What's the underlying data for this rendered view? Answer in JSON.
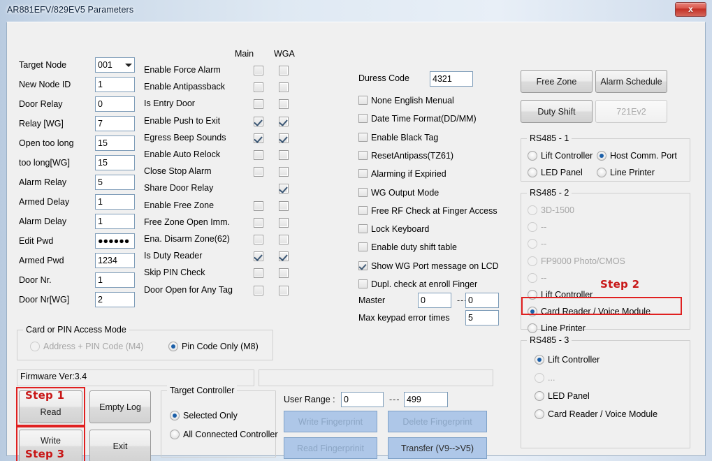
{
  "window": {
    "title": "AR881EFV/829EV5 Parameters",
    "close_label": "x",
    "close_icon": "close-icon"
  },
  "left_fields": [
    {
      "label": "Target Node",
      "value": "001",
      "type": "combo"
    },
    {
      "label": "New Node ID",
      "value": "1",
      "type": "text"
    },
    {
      "label": "Door Relay",
      "value": "0",
      "type": "text"
    },
    {
      "label": "Relay [WG]",
      "value": "7",
      "type": "text"
    },
    {
      "label": "Open too long",
      "value": "15",
      "type": "text"
    },
    {
      "label": "too long[WG]",
      "value": "15",
      "type": "text"
    },
    {
      "label": "Alarm Relay",
      "value": "5",
      "type": "text"
    },
    {
      "label": "Armed Delay",
      "value": "1",
      "type": "text"
    },
    {
      "label": "Alarm Delay",
      "value": "1",
      "type": "text"
    },
    {
      "label": "Edit Pwd",
      "value": "●●●●●●",
      "type": "text"
    },
    {
      "label": "Armed Pwd",
      "value": "1234",
      "type": "text"
    },
    {
      "label": "Door Nr.",
      "value": "1",
      "type": "text"
    },
    {
      "label": "Door Nr[WG]",
      "value": "2",
      "type": "text"
    }
  ],
  "checkbox_columns": {
    "main": "Main",
    "wga": "WGA"
  },
  "option_rows": [
    {
      "label": "Enable Force Alarm",
      "main": false,
      "wga": false,
      "main_present": true,
      "wga_present": true
    },
    {
      "label": "Enable Antipassback",
      "main": false,
      "wga": false,
      "main_present": true,
      "wga_present": true
    },
    {
      "label": "Is Entry Door",
      "main": false,
      "wga": false,
      "main_present": true,
      "wga_present": true
    },
    {
      "label": "Enable Push to Exit",
      "main": true,
      "wga": true,
      "main_present": true,
      "wga_present": true
    },
    {
      "label": "Egress Beep Sounds",
      "main": true,
      "wga": true,
      "main_present": true,
      "wga_present": true
    },
    {
      "label": "Enable Auto Relock",
      "main": false,
      "wga": false,
      "main_present": true,
      "wga_present": true
    },
    {
      "label": "Close Stop Alarm",
      "main": false,
      "wga": false,
      "main_present": true,
      "wga_present": true
    },
    {
      "label": "Share Door Relay",
      "main": false,
      "wga": true,
      "main_present": false,
      "wga_present": true
    },
    {
      "label": "Enable Free Zone",
      "main": false,
      "wga": false,
      "main_present": true,
      "wga_present": true
    },
    {
      "label": "Free Zone Open Imm.",
      "main": false,
      "wga": false,
      "main_present": true,
      "wga_present": true
    },
    {
      "label": "Ena. Disarm Zone(62)",
      "main": false,
      "wga": false,
      "main_present": true,
      "wga_present": true
    },
    {
      "label": "Is Duty Reader",
      "main": true,
      "wga": true,
      "main_present": true,
      "wga_present": true
    },
    {
      "label": "Skip PIN Check",
      "main": false,
      "wga": false,
      "main_present": true,
      "wga_present": true
    },
    {
      "label": "Door Open for Any Tag",
      "main": false,
      "wga": false,
      "main_present": true,
      "wga_present": true
    }
  ],
  "middle": {
    "duress_label": "Duress Code",
    "duress_value": "4321",
    "checks": [
      {
        "label": "None English Menual",
        "checked": false
      },
      {
        "label": "Date Time Format(DD/MM)",
        "checked": false
      },
      {
        "label": "Enable Black Tag",
        "checked": false
      },
      {
        "label": "ResetAntipass(TZ61)",
        "checked": false
      },
      {
        "label": "Alarming if Expiried",
        "checked": false
      },
      {
        "label": "WG Output Mode",
        "checked": false
      },
      {
        "label": "Free RF Check at Finger Access",
        "checked": false
      },
      {
        "label": "Lock Keyboard",
        "checked": false
      },
      {
        "label": "Enable duty shift table",
        "checked": false
      },
      {
        "label": "Show WG Port message on LCD",
        "checked": true
      },
      {
        "label": "Dupl. check at enroll  Finger",
        "checked": false
      }
    ],
    "master_label": "Master",
    "master_from": "0",
    "master_sep": "---",
    "master_to": "0",
    "max_err_label": "Max keypad error times",
    "max_err_value": "5"
  },
  "right": {
    "buttons": [
      {
        "label": "Free Zone",
        "disabled": false
      },
      {
        "label": "Alarm Schedule",
        "disabled": false
      },
      {
        "label": "Duty Shift",
        "disabled": false
      },
      {
        "label": "721Ev2",
        "disabled": true
      }
    ],
    "rs485_1": {
      "title": "RS485 - 1",
      "options": [
        {
          "label": "Lift Controller",
          "selected": false,
          "disabled": false
        },
        {
          "label": "Host Comm. Port",
          "selected": true,
          "disabled": false
        },
        {
          "label": "LED Panel",
          "selected": false,
          "disabled": false
        },
        {
          "label": "Line Printer",
          "selected": false,
          "disabled": false
        }
      ]
    },
    "rs485_2": {
      "title": "RS485 - 2",
      "options": [
        {
          "label": "3D-1500",
          "selected": false,
          "disabled": true
        },
        {
          "label": "--",
          "selected": false,
          "disabled": true
        },
        {
          "label": "--",
          "selected": false,
          "disabled": true
        },
        {
          "label": "FP9000 Photo/CMOS",
          "selected": false,
          "disabled": true
        },
        {
          "label": "--",
          "selected": false,
          "disabled": true
        },
        {
          "label": "Lift Controller",
          "selected": false,
          "disabled": false
        },
        {
          "label": "Card Reader / Voice Module",
          "selected": true,
          "disabled": false
        },
        {
          "label": "Line Printer",
          "selected": false,
          "disabled": false
        }
      ]
    },
    "rs485_3": {
      "title": "RS485 - 3",
      "options": [
        {
          "label": "Lift Controller",
          "selected": true,
          "disabled": false
        },
        {
          "label": "...",
          "selected": false,
          "disabled": true
        },
        {
          "label": "LED Panel",
          "selected": false,
          "disabled": false
        },
        {
          "label": "Card Reader / Voice Module",
          "selected": false,
          "disabled": false
        }
      ]
    }
  },
  "access_mode": {
    "title": "Card or PIN Access Mode",
    "options": [
      {
        "label": "Address + PIN Code (M4)",
        "selected": false,
        "disabled": true
      },
      {
        "label": "Pin Code Only (M8)",
        "selected": true,
        "disabled": false
      }
    ]
  },
  "status": {
    "firmware": "Firmware Ver:3.4",
    "right_panel": ""
  },
  "actions": {
    "read": "Read",
    "empty_log": "Empty Log",
    "write": "Write",
    "exit": "Exit"
  },
  "target_controller": {
    "title": "Target Controller",
    "options": [
      {
        "label": "Selected Only",
        "selected": true
      },
      {
        "label": "All Connected Controller",
        "selected": false
      }
    ]
  },
  "fingerprint": {
    "range_label": "User Range :",
    "range_from": "0",
    "range_sep": "---",
    "range_to": "499",
    "buttons": [
      {
        "label": "Write Fingerprint",
        "disabled": true
      },
      {
        "label": "Delete Fingerprint",
        "disabled": true
      },
      {
        "label": "Read Fingerprinit",
        "disabled": true
      },
      {
        "label": "Transfer (V9-->V5)",
        "disabled": false
      }
    ]
  },
  "annotations": {
    "step1": "Step 1",
    "step2": "Step 2",
    "step3": "Step 3",
    "accent": "#e02020"
  }
}
